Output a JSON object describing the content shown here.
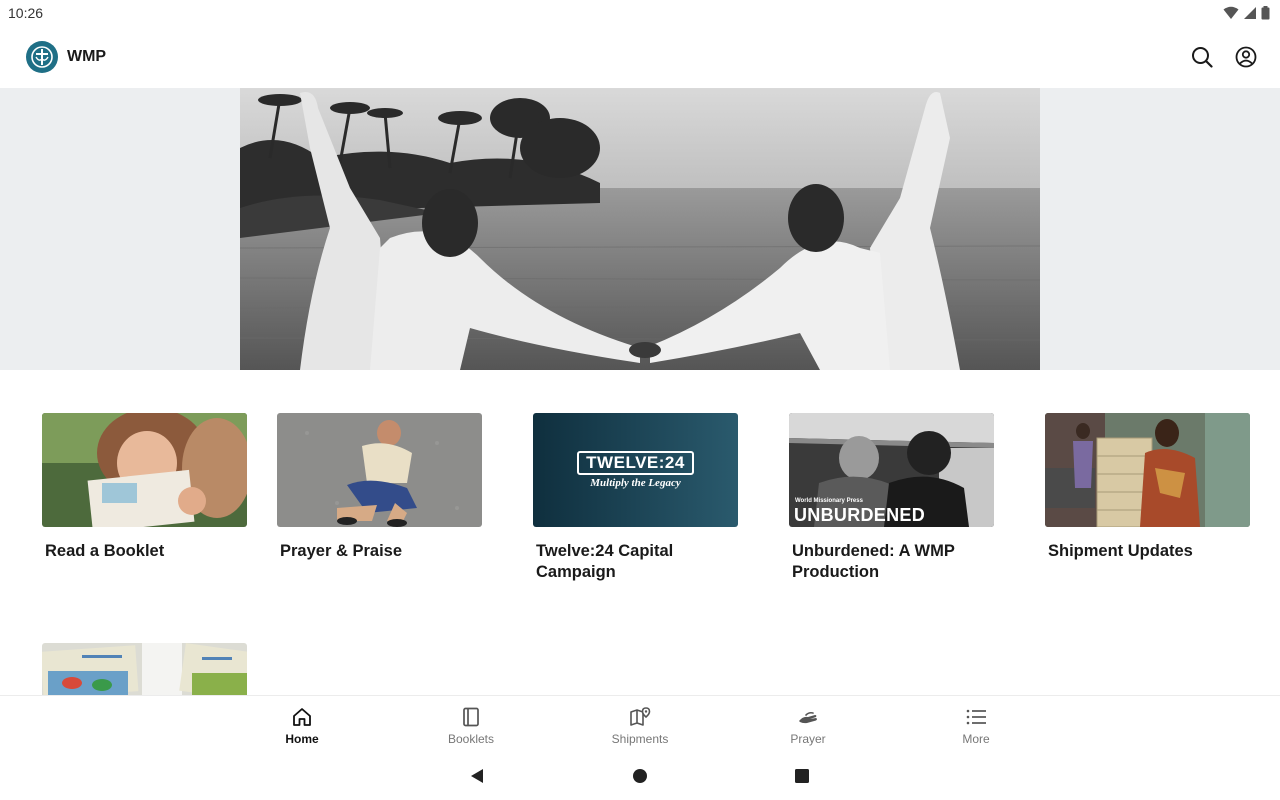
{
  "status_bar": {
    "time": "10:26",
    "icons": [
      "wifi-icon",
      "signal-icon",
      "battery-icon"
    ]
  },
  "app_bar": {
    "brand": "WMP",
    "actions": [
      "search-icon",
      "account-icon"
    ]
  },
  "cards": [
    {
      "title": "Read a Booklet"
    },
    {
      "title": "Prayer & Praise"
    },
    {
      "title": "Twelve:24 Capital Campaign",
      "thumb_text": "TWELVE:24",
      "thumb_subtext": "Multiply the Legacy"
    },
    {
      "title": "Unburdened: A WMP Production",
      "thumb_text": "UNBURDENED",
      "thumb_subtext": "World Missionary Press"
    },
    {
      "title": "Shipment Updates"
    },
    {
      "title": ""
    }
  ],
  "bottom_nav": {
    "items": [
      {
        "label": "Home",
        "icon": "home-icon",
        "active": true
      },
      {
        "label": "Booklets",
        "icon": "booklet-icon",
        "active": false
      },
      {
        "label": "Shipments",
        "icon": "map-pin-icon",
        "active": false
      },
      {
        "label": "Prayer",
        "icon": "prayer-hand-icon",
        "active": false
      },
      {
        "label": "More",
        "icon": "list-icon",
        "active": false
      }
    ]
  },
  "colors": {
    "brand": "#1f6f86",
    "hero_band": "#eceef0",
    "twelve_bg": "#1d4a5a"
  }
}
